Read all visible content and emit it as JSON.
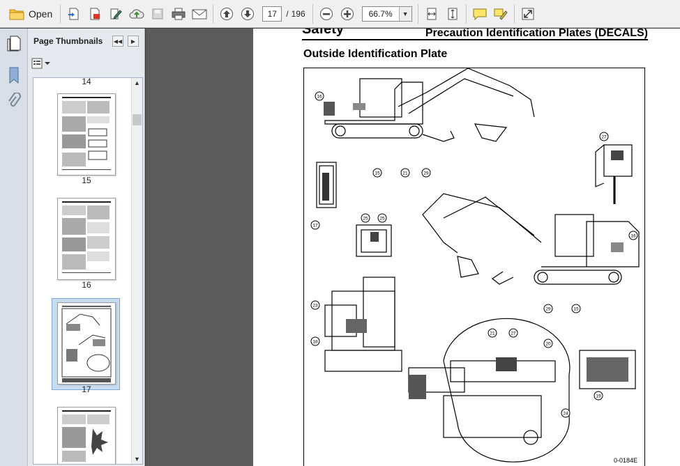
{
  "toolbar": {
    "open_label": "Open",
    "current_page": "17",
    "page_separator": "/",
    "total_pages": "196",
    "zoom": "66.7%"
  },
  "thumbnails": {
    "title": "Page Thumbnails",
    "pages": [
      {
        "number": "14"
      },
      {
        "number": "15"
      },
      {
        "number": "16"
      },
      {
        "number": "17"
      }
    ]
  },
  "document": {
    "header_left": "Safety",
    "header_right": "Precaution Identification Plates (DECALS)",
    "section_title": "Outside Identification Plate",
    "figure_code": "0-0184E",
    "callouts": [
      "16",
      "15",
      "21",
      "29",
      "17",
      "25",
      "25",
      "23",
      "18",
      "27",
      "16",
      "29",
      "15",
      "21",
      "27",
      "20",
      "24",
      "19"
    ]
  },
  "colors": {
    "toolbar_bg": "#f0f0f0",
    "panel_bg": "#e6e9ee",
    "doc_bg": "#5c5c5c",
    "selection": "#c9dcef"
  }
}
